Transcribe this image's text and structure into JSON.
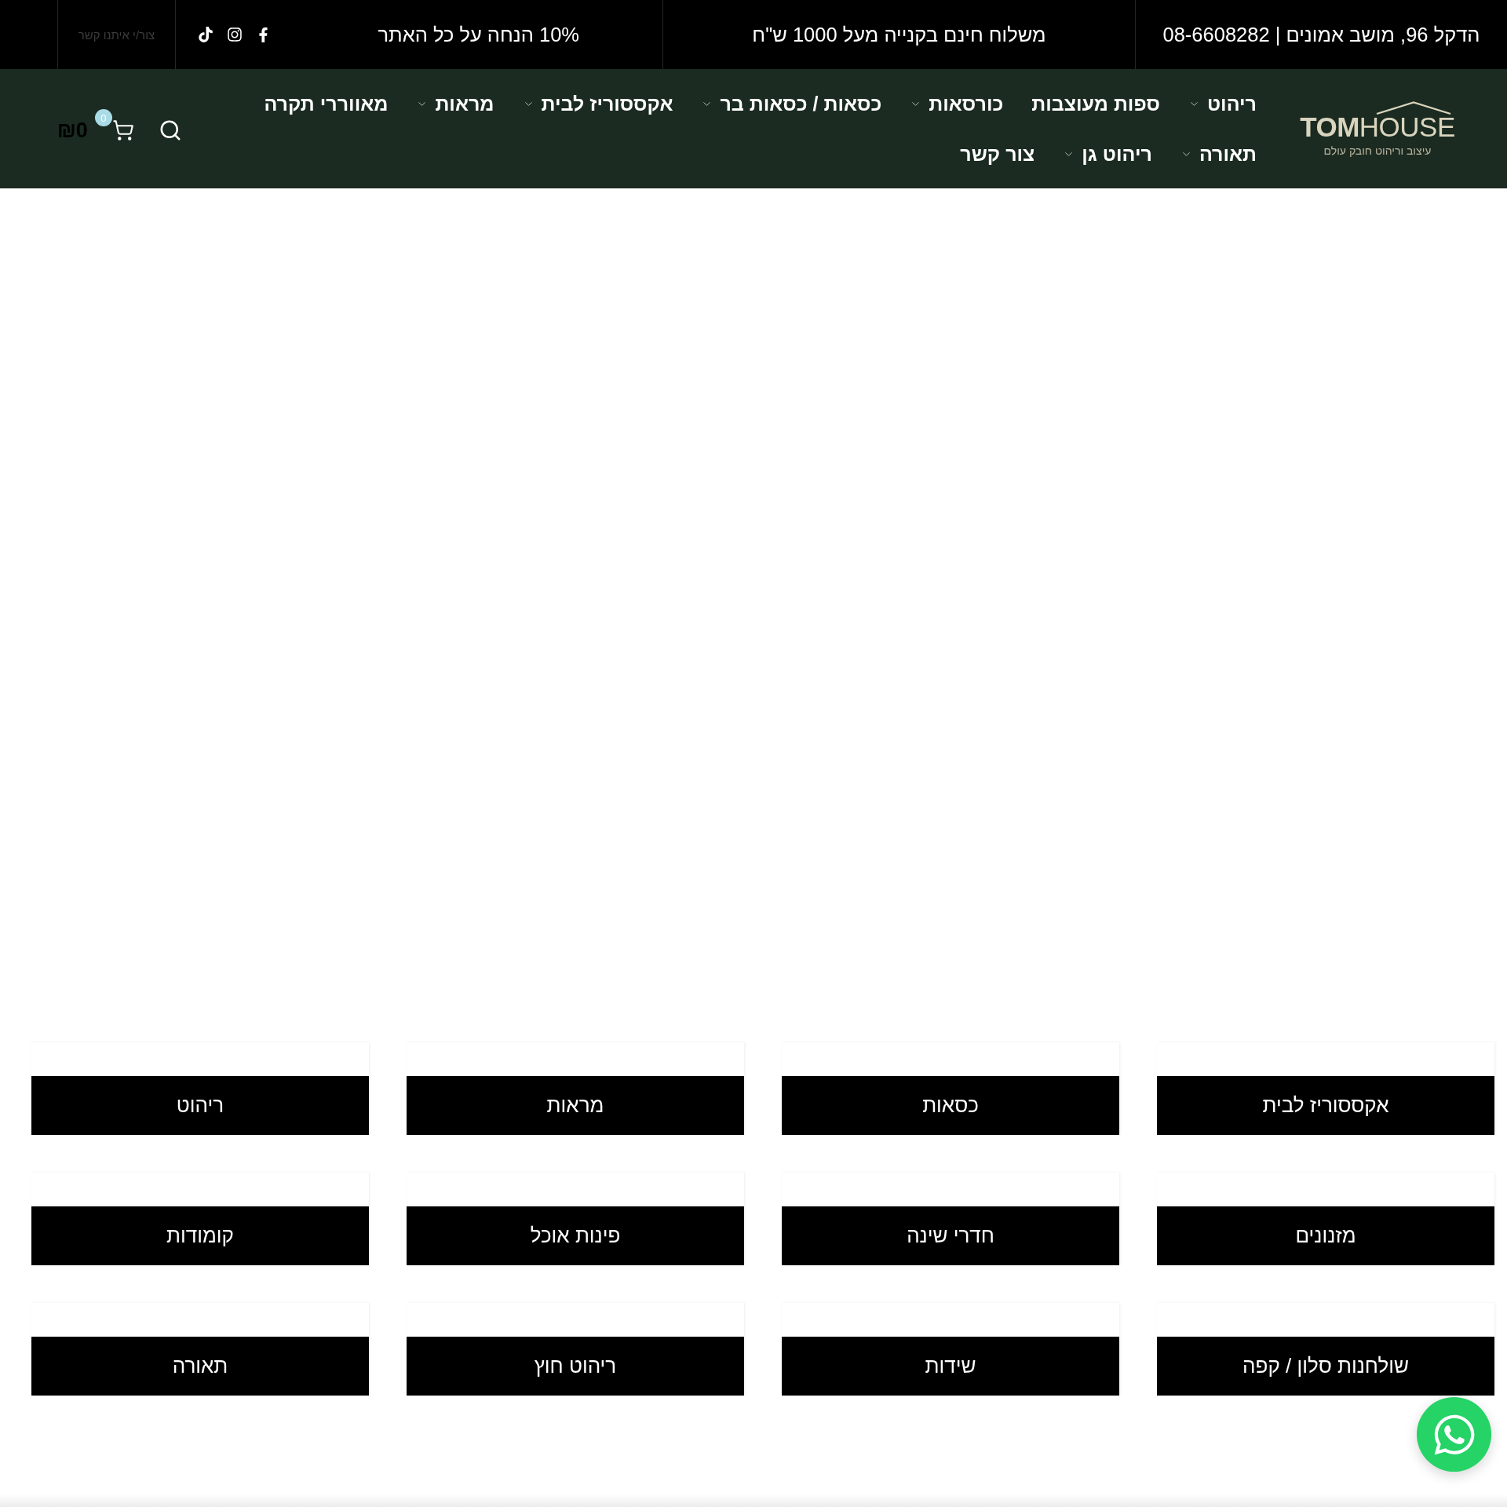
{
  "top_bar": {
    "address": "הדקל 96, מושב אמונים | 08-6608282",
    "shipping": "משלוח חינם בקנייה מעל 1000 ש\"ח",
    "discount": "10% הנחה על כל האתר",
    "social": [
      {
        "kind": "facebook"
      },
      {
        "kind": "instagram"
      },
      {
        "kind": "tiktok"
      }
    ],
    "contact": "צור/י איתנו קשר"
  },
  "header": {
    "logo": {
      "wordmark": "**TOM**HOUSE",
      "tagline": "עיצוב וריהוט חובק עולם"
    },
    "nav": [
      {
        "label": "ריהוט",
        "dropdown": true
      },
      {
        "label": "ספות מעוצבות",
        "dropdown": false
      },
      {
        "label": "כורסאות",
        "dropdown": true
      },
      {
        "label": "כסאות / כסאות בר",
        "dropdown": true
      },
      {
        "label": "אקססוריז לבית",
        "dropdown": true
      },
      {
        "label": "מראות",
        "dropdown": true
      },
      {
        "label": "מאווררי תקרה",
        "dropdown": false
      },
      {
        "label": "תאורה",
        "dropdown": true
      },
      {
        "label": "ריהוט גן",
        "dropdown": true
      },
      {
        "label": "צור קשר",
        "dropdown": false
      }
    ],
    "cart": {
      "badge": "0",
      "total": "₪0"
    }
  },
  "categories": [
    {
      "label": "אקססוריז לבית"
    },
    {
      "label": "כסאות"
    },
    {
      "label": "מראות"
    },
    {
      "label": "ריהוט"
    },
    {
      "label": "מזנונים"
    },
    {
      "label": "חדרי שינה"
    },
    {
      "label": "פינות אוכל"
    },
    {
      "label": "קומודות"
    },
    {
      "label": "שולחנות סלון / קפה"
    },
    {
      "label": "שידות"
    },
    {
      "label": "ריהוט חוץ"
    },
    {
      "label": "תאורה"
    }
  ]
}
